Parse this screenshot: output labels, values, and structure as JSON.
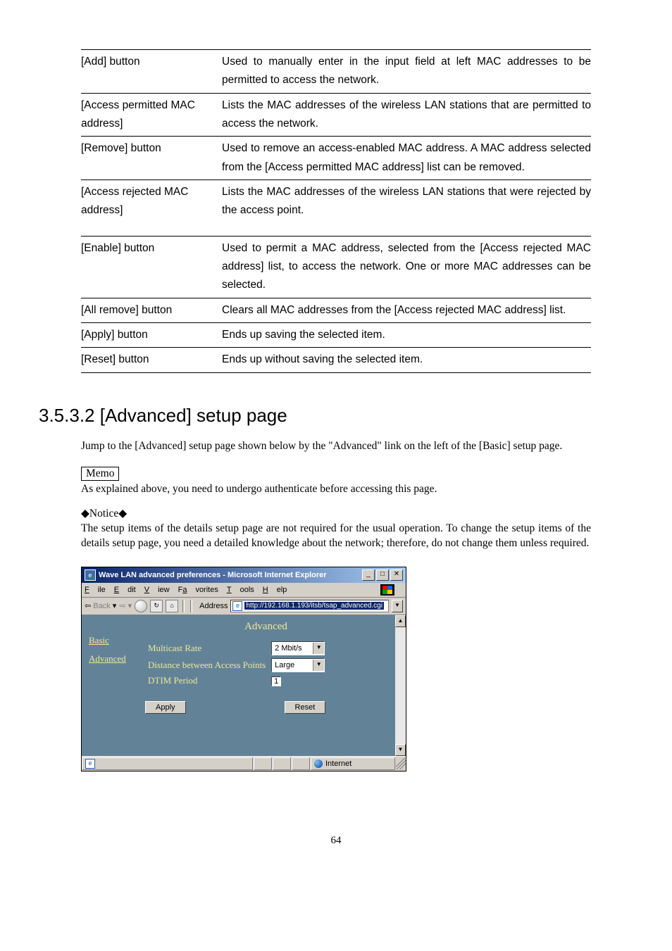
{
  "table_rows": [
    {
      "name": "[Add] button",
      "desc": "Used to manually enter in the input field at left MAC addresses to be permitted to access the network."
    },
    {
      "name": "[Access permitted MAC address]",
      "desc": "Lists the MAC addresses of the wireless LAN stations that are permitted to access the network."
    },
    {
      "name": "[Remove] button",
      "desc": "Used to remove an access-enabled MAC address.  A MAC address selected from the [Access permitted MAC address] list can be removed."
    },
    {
      "name": "[Access rejected MAC address]",
      "desc": "Lists the MAC addresses of the wireless LAN stations that were rejected by the access point."
    },
    {
      "name": "[Enable] button",
      "desc": "Used to permit a MAC address, selected from the [Access rejected MAC address] list, to access the network.\nOne or more MAC addresses can be selected."
    },
    {
      "name": "[All remove] button",
      "desc": "Clears all MAC addresses from the [Access rejected MAC address] list."
    },
    {
      "name": "[Apply] button",
      "desc": "Ends up saving the selected item."
    },
    {
      "name": "[Reset] button",
      "desc": "Ends up without saving the selected item."
    }
  ],
  "section_heading": "3.5.3.2  [Advanced] setup page",
  "intro_text": "Jump to the [Advanced] setup page shown below by the \"Advanced\" link on the left of the [Basic] setup page.",
  "memo_label": "Memo",
  "memo_text": "As explained above, you need to undergo authenticate before accessing this page.",
  "notice_label": "◆Notice◆",
  "notice_text": "The setup items of the details setup page are not required for the usual operation.  To change the setup items of the details setup page, you need a detailed knowledge about the network; therefore, do not change them unless required.",
  "page_number": "64",
  "ie": {
    "title": "Wave LAN advanced preferences - Microsoft Internet Explorer",
    "menus": {
      "file": "File",
      "edit": "Edit",
      "view": "View",
      "favorites": "Favorites",
      "tools": "Tools",
      "help": "Help"
    },
    "toolbar": {
      "back": "Back",
      "address_label": "Address",
      "url_display": "http://192.168.1.193/itsb/tsap_advanced.cgi"
    },
    "sidebar": {
      "basic": "Basic",
      "advanced": "Advanced"
    },
    "panel": {
      "title": "Advanced",
      "multicast_label": "Multicast Rate",
      "multicast_value": "2 Mbit/s",
      "distance_label": "Distance between Access Points",
      "distance_value": "Large",
      "dtim_label": "DTIM Period",
      "dtim_value": "1",
      "apply": "Apply",
      "reset": "Reset"
    },
    "status": {
      "zone": "Internet"
    }
  }
}
